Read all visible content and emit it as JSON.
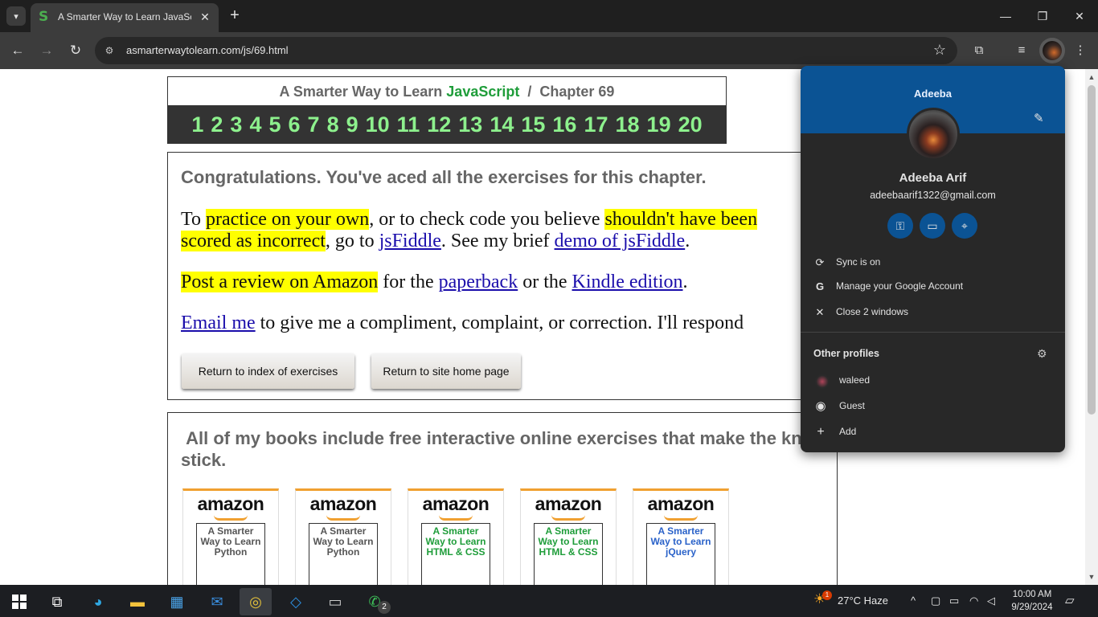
{
  "browser": {
    "tab_title": "A Smarter Way to Learn JavaScript",
    "url": "asmarterwaytolearn.com/js/69.html"
  },
  "page": {
    "site_name": "A Smarter Way to Learn",
    "site_name_js": "JavaScript",
    "chapter_sep": "/",
    "chapter": "Chapter 69",
    "chapter_numbers": [
      "1",
      "2",
      "3",
      "4",
      "5",
      "6",
      "7",
      "8",
      "9",
      "10",
      "11",
      "12",
      "13",
      "14",
      "15",
      "16",
      "17",
      "18",
      "19",
      "20"
    ],
    "congrats": "Congratulations. You've aced all the exercises for this chapter.",
    "p1": {
      "t1": "To ",
      "h1": "practice on your own",
      "t2": ", or to check code you believe ",
      "h2": "shouldn't have been",
      "h3": "scored as incorrect",
      "t3": ", go to ",
      "l1": "jsFiddle",
      "t4": ". See my brief ",
      "l2": "demo of jsFiddle",
      "t5": "."
    },
    "p2": {
      "h1": "Post a review on Amazon",
      "t1": " for the ",
      "l1": "paperback",
      "t2": " or the ",
      "l2": "Kindle edition",
      "t3": "."
    },
    "p3": {
      "l1": "Email me",
      "t1": " to give me a compliment, complaint, or correction. I'll respond"
    },
    "btn_index": "Return to index of exercises",
    "btn_home": "Return to site home page",
    "books_heading": "All of my books include free interactive online exercises that make the knowledge stick.",
    "books": [
      {
        "store": "amazon",
        "cover": "A Smarter Way to Learn Python",
        "color": "#555555"
      },
      {
        "store": "amazon",
        "cover": "A Smarter Way to Learn Python",
        "color": "#555555"
      },
      {
        "store": "amazon",
        "cover": "A Smarter Way to Learn HTML & CSS",
        "color": "#1f9d3a"
      },
      {
        "store": "amazon",
        "cover": "A Smarter Way to Learn HTML & CSS",
        "color": "#1f9d3a"
      },
      {
        "store": "amazon",
        "cover": "A Smarter Way to Learn jQuery",
        "color": "#2a62c9"
      }
    ]
  },
  "profile": {
    "header_name": "Adeeba",
    "full_name": "Adeeba Arif",
    "email": "adeebaarif1322@gmail.com",
    "sync": "Sync is on",
    "manage": "Manage your Google Account",
    "close_windows": "Close 2 windows",
    "other_profiles": "Other profiles",
    "profiles": [
      "waleed",
      "Guest",
      "Add"
    ]
  },
  "taskbar": {
    "weather": "27°C  Haze",
    "time": "10:00 AM",
    "date": "9/29/2024",
    "whatsapp_badge": "2",
    "weather_badge": "1"
  },
  "colors": {
    "accent_blue": "#0b5394",
    "highlight": "#ffff00",
    "chapter_numbers": "#8df18d"
  }
}
